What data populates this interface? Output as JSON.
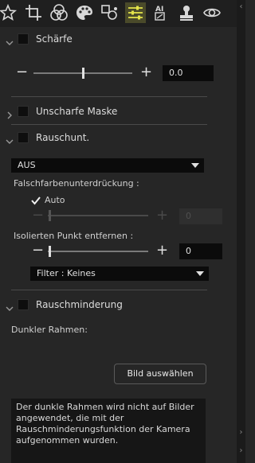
{
  "toolbar": {
    "tools": [
      {
        "name": "star-icon",
        "active": false
      },
      {
        "name": "crop-icon",
        "active": false
      },
      {
        "name": "color-circles-icon",
        "active": false
      },
      {
        "name": "palette-icon",
        "active": false
      },
      {
        "name": "retouch-icon",
        "active": false
      },
      {
        "name": "sliders-icon",
        "active": true
      },
      {
        "name": "ai-icon",
        "active": false
      },
      {
        "name": "stamp-icon",
        "active": false
      },
      {
        "name": "eye-icon",
        "active": false
      }
    ],
    "ai_label": "AI"
  },
  "sharpness": {
    "title": "Schärfe",
    "value": "0.0",
    "slider_level": 0.5
  },
  "unsharp_mask": {
    "title": "Unscharfe Maske"
  },
  "noise_reduction": {
    "title": "Rauschunt.",
    "mode": "AUS",
    "false_color_label": "Falschfarbenunterdrückung :",
    "auto_label": "Auto",
    "auto_checked": true,
    "false_color_value": "0",
    "hot_pixel_label": "Isolierten Punkt entfernen :",
    "hot_pixel_value": "0",
    "filter_select": "Filter : Keines"
  },
  "long_exposure_nr": {
    "title": "Rauschminderung",
    "dark_frame_label": "Dunkler Rahmen:",
    "select_image_button": "Bild auswählen",
    "info_text": "Der dunkle Rahmen wird nicht auf Bilder angewendet, die mit der Rauschminderungsfunktion der Kamera aufgenommen wurden."
  },
  "colors": {
    "accent_active": "#e6e64a",
    "panel_bg": "#262626",
    "field_bg": "#0b0b0b"
  }
}
